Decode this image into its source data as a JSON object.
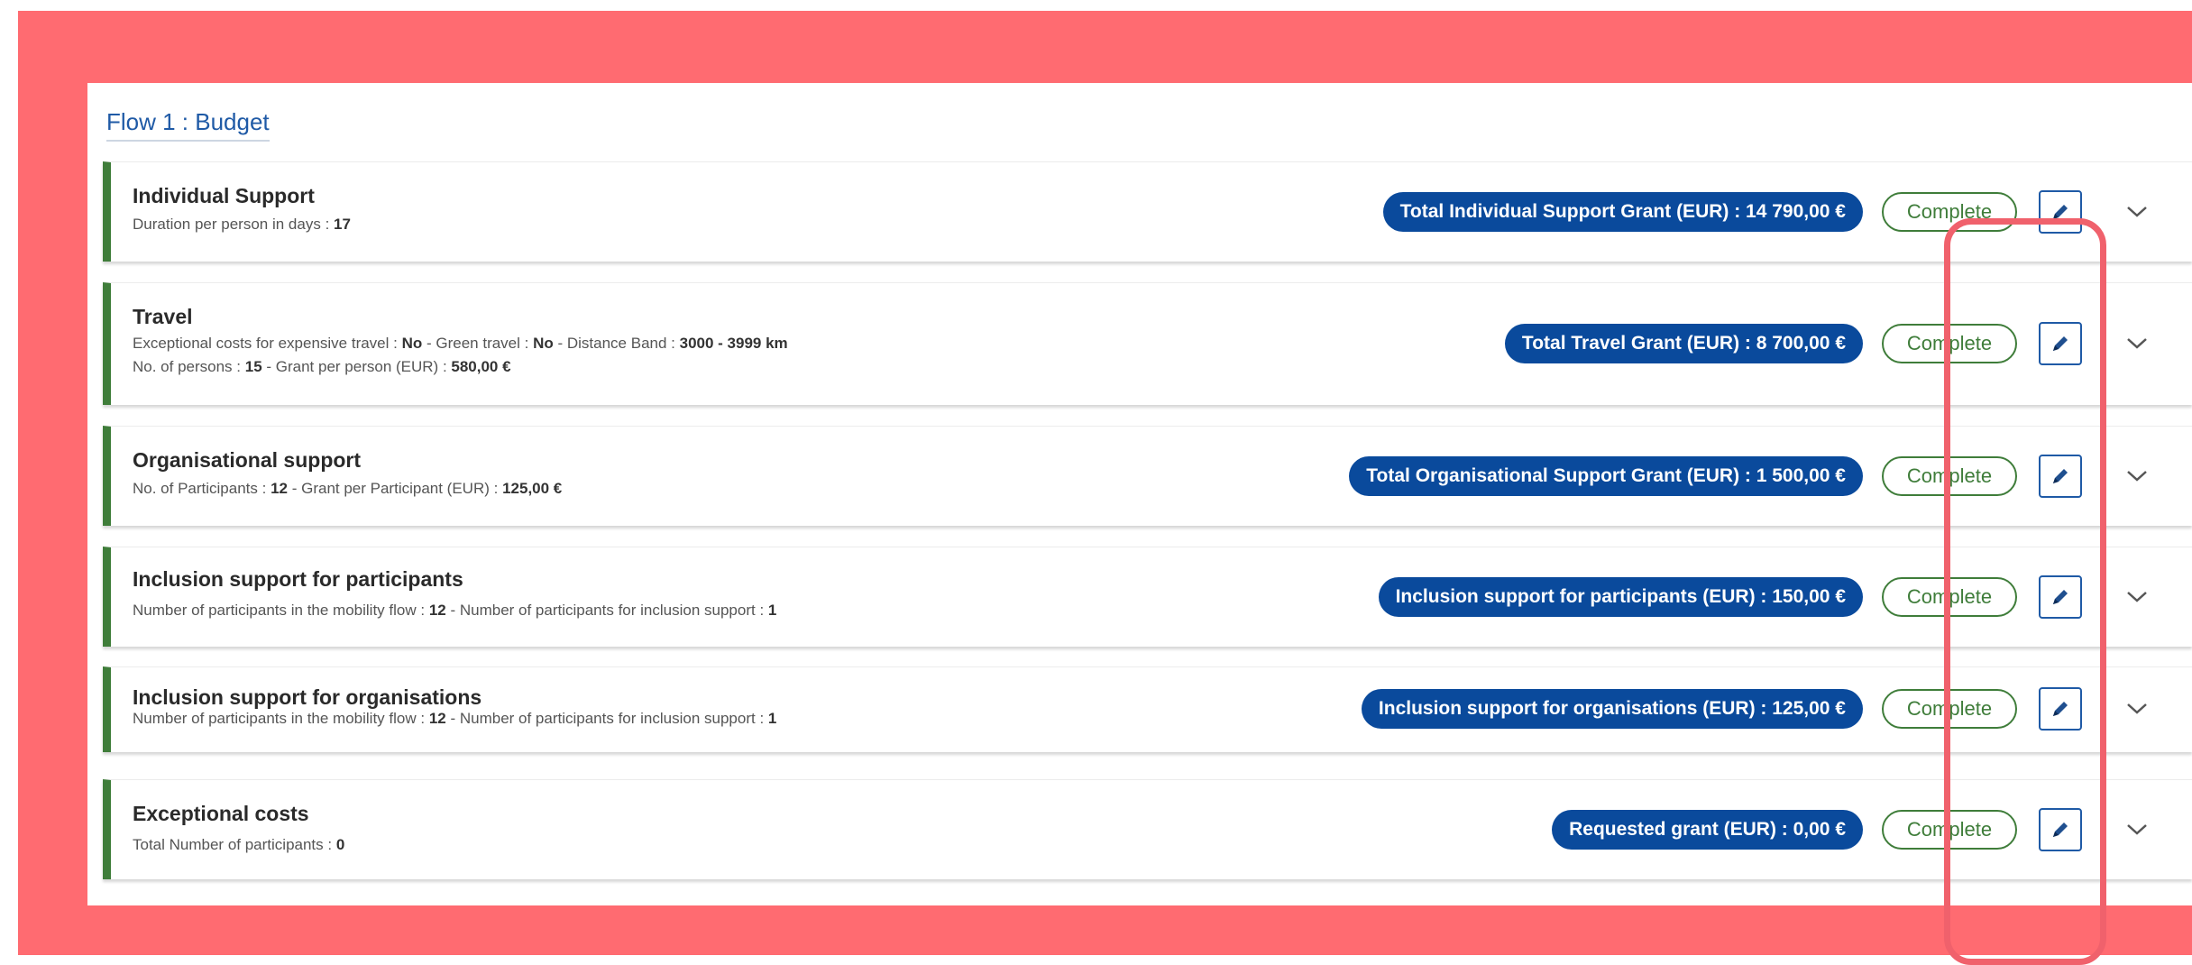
{
  "flow": {
    "title": "Flow 1 : Budget"
  },
  "colors": {
    "accent_green": "#3f7d3a",
    "badge_blue": "#0a4a9c",
    "frame_red": "#ff6b71",
    "highlight_red": "#f0616c"
  },
  "rows": [
    {
      "title": "Individual Support",
      "line1": [
        {
          "t": "Duration per person in days : ",
          "b": false
        },
        {
          "t": "17",
          "b": true
        }
      ],
      "line2": [],
      "grant": "Total Individual Support Grant (EUR) : 14 790,00 €",
      "status": "Complete"
    },
    {
      "title": "Travel",
      "line1": [
        {
          "t": "Exceptional costs for expensive travel : ",
          "b": false
        },
        {
          "t": "No",
          "b": true
        },
        {
          "t": " - Green travel : ",
          "b": false
        },
        {
          "t": "No",
          "b": true
        },
        {
          "t": " - Distance Band : ",
          "b": false
        },
        {
          "t": "3000 - 3999 km",
          "b": true
        }
      ],
      "line2": [
        {
          "t": "No. of persons : ",
          "b": false
        },
        {
          "t": "15",
          "b": true
        },
        {
          "t": " - Grant per person (EUR) : ",
          "b": false
        },
        {
          "t": "580,00 €",
          "b": true
        }
      ],
      "grant": "Total Travel Grant (EUR) : 8 700,00 €",
      "status": "Complete"
    },
    {
      "title": "Organisational support",
      "line1": [
        {
          "t": "No. of Participants : ",
          "b": false
        },
        {
          "t": "12",
          "b": true
        },
        {
          "t": " - Grant per Participant (EUR) : ",
          "b": false
        },
        {
          "t": "125,00 €",
          "b": true
        }
      ],
      "line2": [],
      "grant": "Total Organisational Support Grant (EUR) : 1 500,00 €",
      "status": "Complete"
    },
    {
      "title": "Inclusion support for participants",
      "line1": [
        {
          "t": "Number of participants in the mobility flow : ",
          "b": false
        },
        {
          "t": "12",
          "b": true
        },
        {
          "t": " - Number of participants for inclusion support : ",
          "b": false
        },
        {
          "t": "1",
          "b": true
        }
      ],
      "line2": [],
      "grant": "Inclusion support for participants (EUR) : 150,00 €",
      "status": "Complete"
    },
    {
      "title": "Inclusion support for organisations",
      "line1": [
        {
          "t": "Number of participants in the mobility flow : ",
          "b": false
        },
        {
          "t": "12",
          "b": true
        },
        {
          "t": " - Number of participants for inclusion support : ",
          "b": false
        },
        {
          "t": "1",
          "b": true
        }
      ],
      "line2": [],
      "grant": "Inclusion support for organisations (EUR) : 125,00 €",
      "status": "Complete"
    },
    {
      "title": "Exceptional costs",
      "line1": [
        {
          "t": "Total Number of participants : ",
          "b": false
        },
        {
          "t": "0",
          "b": true
        }
      ],
      "line2": [],
      "grant": "Requested grant (EUR) : 0,00 €",
      "status": "Complete"
    }
  ]
}
